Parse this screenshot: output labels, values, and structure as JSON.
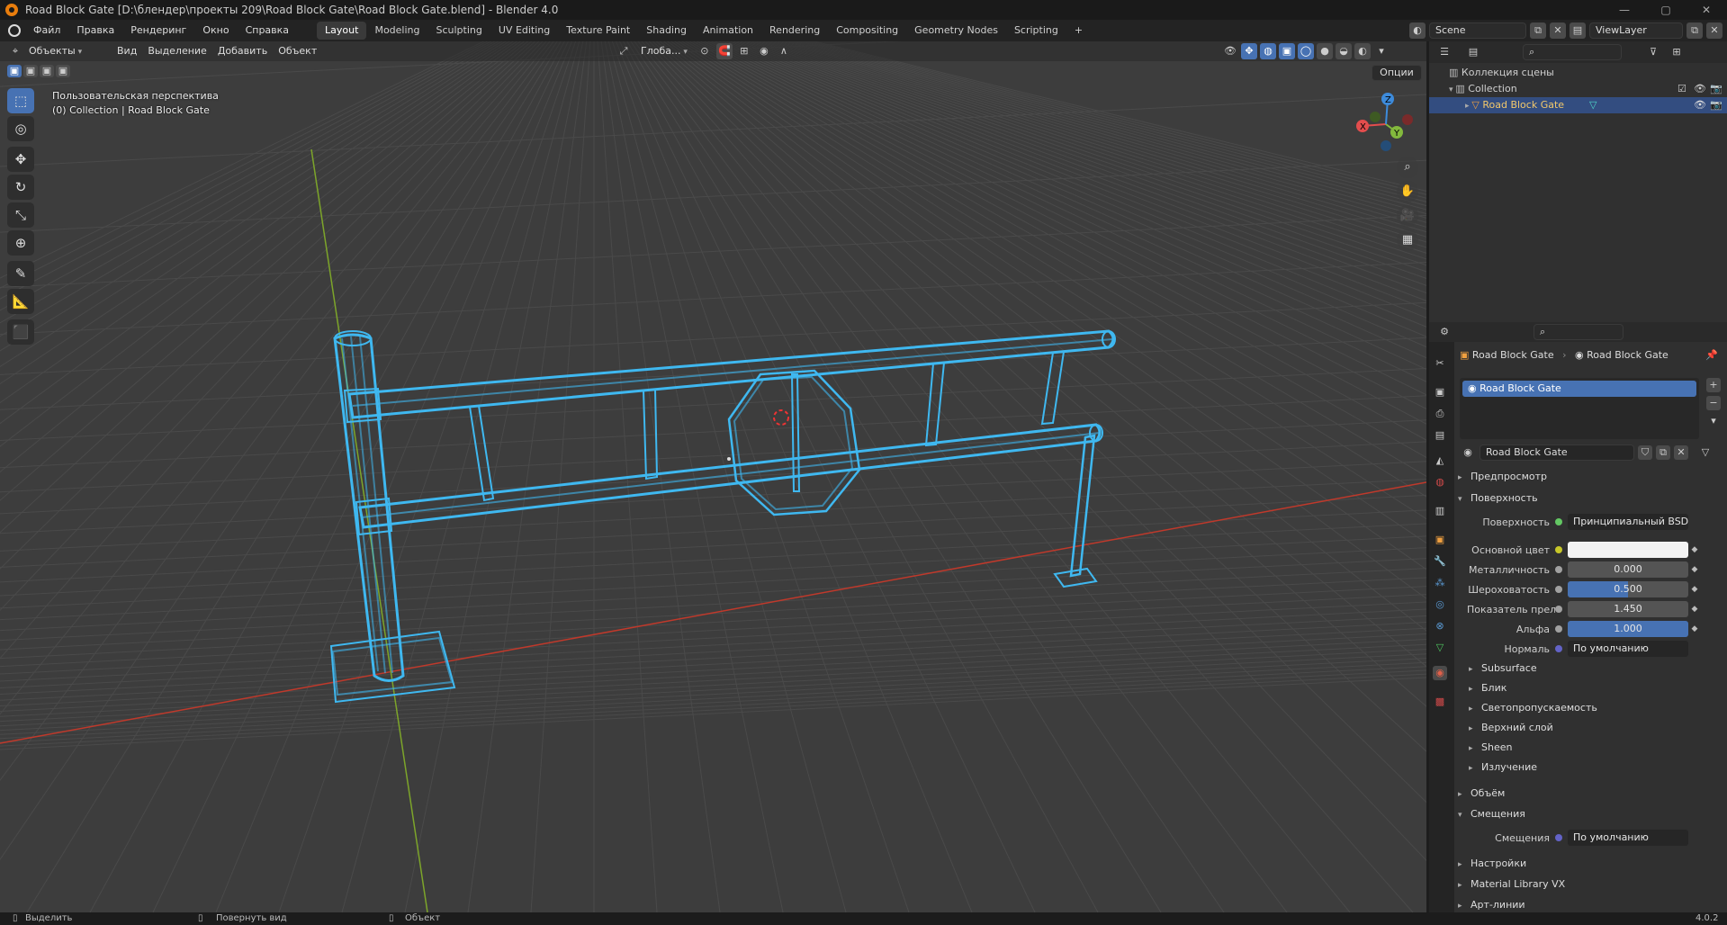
{
  "window": {
    "title": "Road Block Gate [D:\\блендер\\проекты 209\\Road Block Gate\\Road Block Gate.blend] - Blender 4.0",
    "minimize": "—",
    "maximize": "▢",
    "close": "✕"
  },
  "menu": [
    "Файл",
    "Правка",
    "Рендеринг",
    "Окно",
    "Справка"
  ],
  "workspaces": {
    "tabs": [
      "Layout",
      "Modeling",
      "Sculpting",
      "UV Editing",
      "Texture Paint",
      "Shading",
      "Animation",
      "Rendering",
      "Compositing",
      "Geometry Nodes",
      "Scripting"
    ],
    "active": "Layout",
    "add": "+"
  },
  "scene": {
    "label": "Scene",
    "view_layer": "ViewLayer"
  },
  "viewport_header": {
    "mode": "Объекты",
    "menus": [
      "Вид",
      "Выделение",
      "Добавить",
      "Объект"
    ],
    "orientation": "Глоба...",
    "options": "Опции"
  },
  "viewport": {
    "perspective": "Пользовательская перспектива",
    "context": "(0) Collection | Road Block Gate",
    "gizmo": {
      "x": "X",
      "y": "Y",
      "z": "Z"
    },
    "wire_color": "#3fb8f0",
    "grid_color": "#4a4a4a",
    "x_axis_color": "#c0392b",
    "y_axis_color": "#7da52a"
  },
  "tools": [
    {
      "name": "select-box-icon",
      "glyph": "⬚",
      "active": true
    },
    {
      "name": "cursor-icon",
      "glyph": "◎",
      "active": false
    },
    {
      "name": "move-icon",
      "glyph": "✥",
      "active": false
    },
    {
      "name": "rotate-icon",
      "glyph": "↻",
      "active": false
    },
    {
      "name": "scale-icon",
      "glyph": "⤡",
      "active": false
    },
    {
      "name": "transform-icon",
      "glyph": "⊕",
      "active": false
    },
    {
      "name": "annotate-icon",
      "glyph": "✎",
      "active": false
    },
    {
      "name": "measure-icon",
      "glyph": "📐",
      "active": false
    },
    {
      "name": "add-cube-icon",
      "glyph": "⬛",
      "active": false
    }
  ],
  "outliner": {
    "scene_collection": "Коллекция сцены",
    "collection": "Collection",
    "object": "Road Block Gate"
  },
  "properties": {
    "breadcrumb_object": "Road Block Gate",
    "breadcrumb_material": "Road Block Gate",
    "slot": "Road Block Gate",
    "material_name": "Road Block Gate",
    "sections": {
      "preview": "Предпросмотр",
      "surface": "Поверхность",
      "volume": "Объём",
      "displacement": "Смещения",
      "settings": "Настройки",
      "material_library": "Material Library VX",
      "line_art": "Арт-линии"
    },
    "surface_label": "Поверхность",
    "surface_value": "Принципиальный BSDF",
    "base_color_label": "Основной цвет",
    "metallic_label": "Металличность",
    "metallic": "0.000",
    "roughness_label": "Шероховатость",
    "roughness": "0.500",
    "ior_label": "Показатель прело...",
    "ior": "1.450",
    "alpha_label": "Альфа",
    "alpha": "1.000",
    "normal_label": "Нормаль",
    "normal_value": "По умолчанию",
    "subpanels": [
      "Subsurface",
      "Блик",
      "Светопропускаемость",
      "Верхний слой",
      "Sheen",
      "Излучение"
    ],
    "displacement_label": "Смещения",
    "displacement_value": "По умолчанию"
  },
  "statusbar": {
    "select": "Выделить",
    "rotate": "Повернуть вид",
    "object": "Объект",
    "version": "4.0.2"
  }
}
